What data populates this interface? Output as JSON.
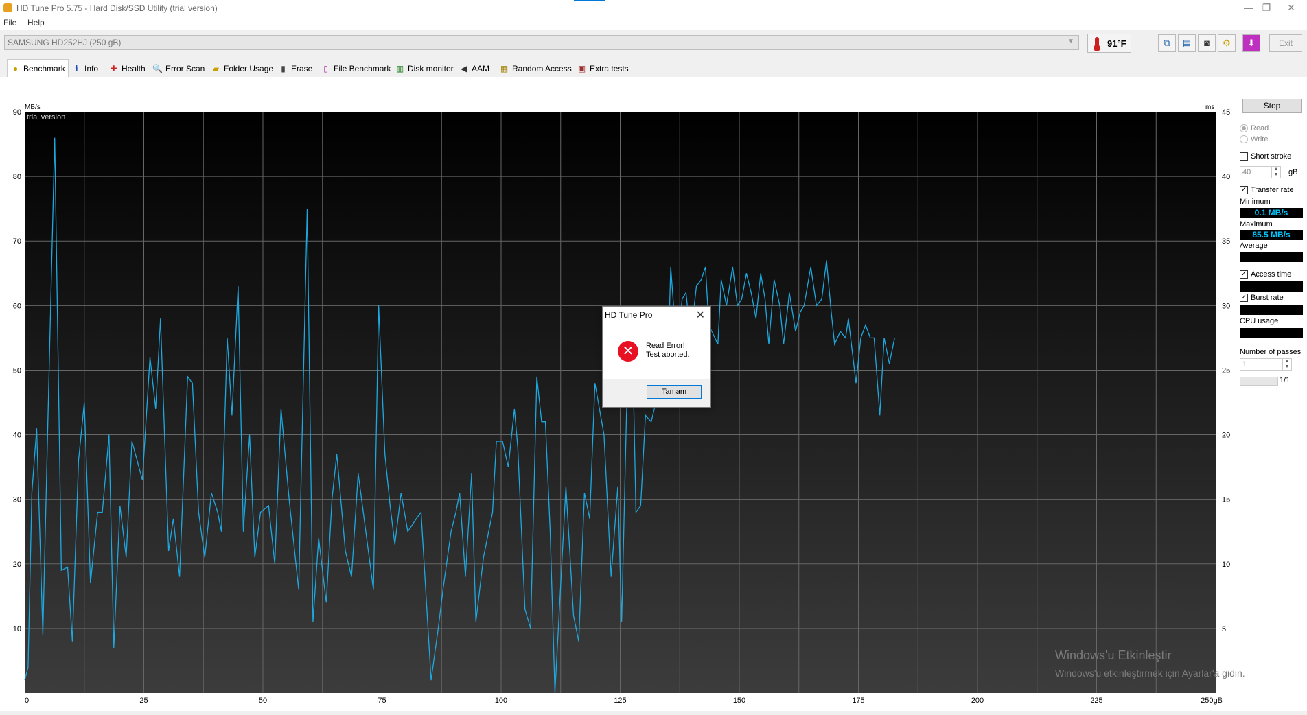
{
  "window": {
    "title": "HD Tune Pro 5.75 - Hard Disk/SSD Utility (trial version)",
    "minimize": "—",
    "restore": "❐",
    "close": "✕"
  },
  "menu": {
    "file": "File",
    "help": "Help"
  },
  "toolbar": {
    "drive": "SAMSUNG HD252HJ (250 gB)",
    "temperature": "91°F",
    "exit": "Exit"
  },
  "tabs": [
    {
      "label": "Benchmark",
      "icon": "benchmark-icon"
    },
    {
      "label": "Info",
      "icon": "info-icon"
    },
    {
      "label": "Health",
      "icon": "health-icon"
    },
    {
      "label": "Error Scan",
      "icon": "error-scan-icon"
    },
    {
      "label": "Folder Usage",
      "icon": "folder-icon"
    },
    {
      "label": "Erase",
      "icon": "erase-icon"
    },
    {
      "label": "File Benchmark",
      "icon": "file-benchmark-icon"
    },
    {
      "label": "Disk monitor",
      "icon": "disk-monitor-icon"
    },
    {
      "label": "AAM",
      "icon": "speaker-icon"
    },
    {
      "label": "Random Access",
      "icon": "random-access-icon"
    },
    {
      "label": "Extra tests",
      "icon": "extra-tests-icon"
    }
  ],
  "sidebar": {
    "stop": "Stop",
    "read": "Read",
    "write": "Write",
    "short_stroke": "Short stroke",
    "short_stroke_value": "40",
    "short_stroke_unit": "gB",
    "transfer_rate": "Transfer rate",
    "minimum_label": "Minimum",
    "minimum_value": "0.1 MB/s",
    "maximum_label": "Maximum",
    "maximum_value": "85.5 MB/s",
    "average_label": "Average",
    "access_time": "Access time",
    "burst_rate": "Burst rate",
    "cpu_usage": "CPU usage",
    "passes_label": "Number of passes",
    "passes_value": "1",
    "pass_progress": "1/1"
  },
  "dialog": {
    "title": "HD Tune Pro",
    "line1": "Read Error!",
    "line2": "Test aborted.",
    "ok": "Tamam"
  },
  "activation": {
    "line1": "Windows'u Etkinleştir",
    "line2": "Windows'u etkinleştirmek için Ayarlar'a gidin."
  },
  "colors": {
    "plot_line": "#1ea8e0",
    "plot_bg_top": "#000000",
    "plot_bg_bottom": "#3c3c3c",
    "error_icon": "#e81123"
  },
  "chart_data": {
    "type": "line",
    "title": "",
    "watermark": "trial version",
    "ylabel": "MB/s",
    "ylabel_right": "ms",
    "xunit": "gB",
    "xlim": [
      0,
      250
    ],
    "ylim": [
      0,
      90
    ],
    "ylim_right": [
      0,
      45
    ],
    "x_ticks": [
      0,
      25,
      50,
      75,
      100,
      125,
      150,
      175,
      200,
      225,
      250
    ],
    "x_tick_labels": [
      "0",
      "25",
      "50",
      "75",
      "100",
      "125",
      "150",
      "175",
      "200",
      "225",
      "250gB"
    ],
    "y_ticks": [
      10,
      20,
      30,
      40,
      50,
      60,
      70,
      80,
      90
    ],
    "y_right_ticks": [
      5,
      10,
      15,
      20,
      25,
      30,
      35,
      40,
      45
    ],
    "grid": true,
    "series": [
      {
        "values": [
          [
            0,
            2
          ],
          [
            0.7,
            4
          ],
          [
            1.5,
            31
          ],
          [
            2.5,
            41
          ],
          [
            3.8,
            9
          ],
          [
            4.8,
            40
          ],
          [
            6.3,
            86
          ],
          [
            7.7,
            19
          ],
          [
            9,
            19.5
          ],
          [
            10,
            8
          ],
          [
            11.3,
            36
          ],
          [
            12.5,
            45
          ],
          [
            13.8,
            17
          ],
          [
            15.3,
            28
          ],
          [
            16.3,
            28
          ],
          [
            17.7,
            40
          ],
          [
            18.7,
            7
          ],
          [
            20,
            29
          ],
          [
            21.3,
            21
          ],
          [
            22.5,
            39
          ],
          [
            24.7,
            33
          ],
          [
            26.3,
            52
          ],
          [
            27.5,
            44
          ],
          [
            28.5,
            58
          ],
          [
            30.2,
            22
          ],
          [
            31.2,
            27
          ],
          [
            32.5,
            18
          ],
          [
            34.2,
            49
          ],
          [
            35.2,
            48
          ],
          [
            36.5,
            28
          ],
          [
            37.8,
            21
          ],
          [
            39.2,
            31
          ],
          [
            40.5,
            28
          ],
          [
            41.3,
            25
          ],
          [
            42.5,
            55
          ],
          [
            43.5,
            43
          ],
          [
            44.8,
            63
          ],
          [
            45.9,
            25
          ],
          [
            47.2,
            40
          ],
          [
            48.3,
            21
          ],
          [
            49.5,
            28
          ],
          [
            51.2,
            29
          ],
          [
            52.5,
            20
          ],
          [
            53.8,
            44
          ],
          [
            55.5,
            30
          ],
          [
            57.5,
            16
          ],
          [
            59.3,
            75
          ],
          [
            60.5,
            11
          ],
          [
            61.7,
            24
          ],
          [
            63.3,
            14
          ],
          [
            64.5,
            30
          ],
          [
            65.5,
            37
          ],
          [
            67.3,
            22
          ],
          [
            68.6,
            18
          ],
          [
            70,
            34
          ],
          [
            71.6,
            25
          ],
          [
            73.2,
            16
          ],
          [
            74.3,
            60
          ],
          [
            75.6,
            37
          ],
          [
            76.7,
            29
          ],
          [
            77.7,
            23
          ],
          [
            79,
            31
          ],
          [
            80.4,
            25
          ],
          [
            82.2,
            27
          ],
          [
            83.2,
            28
          ],
          [
            85.3,
            2
          ],
          [
            86.8,
            10
          ],
          [
            87.8,
            16
          ],
          [
            89.5,
            25
          ],
          [
            90.5,
            28
          ],
          [
            91.3,
            31
          ],
          [
            92.5,
            18
          ],
          [
            93.8,
            34
          ],
          [
            94.7,
            11
          ],
          [
            96.3,
            21
          ],
          [
            98.2,
            28
          ],
          [
            99,
            39
          ],
          [
            100.3,
            39
          ],
          [
            101.5,
            35
          ],
          [
            102.8,
            44
          ],
          [
            103.5,
            38
          ],
          [
            105,
            13
          ],
          [
            106.2,
            10
          ],
          [
            107.5,
            49
          ],
          [
            108.5,
            42
          ],
          [
            109.3,
            42
          ],
          [
            110.3,
            25
          ],
          [
            111.3,
            0
          ],
          [
            113.6,
            32
          ],
          [
            115.2,
            12
          ],
          [
            116.3,
            8
          ],
          [
            117.5,
            31
          ],
          [
            118.6,
            27
          ],
          [
            119.7,
            48
          ],
          [
            121.6,
            40
          ],
          [
            123.1,
            18
          ],
          [
            124.5,
            32
          ],
          [
            125.3,
            11
          ],
          [
            126.6,
            52
          ],
          [
            127.5,
            57
          ],
          [
            128.3,
            28
          ],
          [
            129.3,
            29
          ],
          [
            130.3,
            43
          ],
          [
            131.5,
            42
          ],
          [
            133.8,
            49
          ],
          [
            135,
            50
          ],
          [
            135.6,
            66
          ],
          [
            136.4,
            58
          ],
          [
            137,
            54
          ],
          [
            138,
            61
          ],
          [
            138.8,
            62
          ],
          [
            139.8,
            55
          ],
          [
            141,
            63
          ],
          [
            142,
            64
          ],
          [
            142.9,
            66
          ],
          [
            143.6,
            57
          ],
          [
            145.5,
            54
          ],
          [
            146.2,
            64
          ],
          [
            147.3,
            60
          ],
          [
            148.6,
            66
          ],
          [
            149.6,
            60
          ],
          [
            150.5,
            61
          ],
          [
            151.5,
            65
          ],
          [
            152.5,
            62
          ],
          [
            153.5,
            58
          ],
          [
            154.5,
            65
          ],
          [
            155.4,
            61
          ],
          [
            156.2,
            54
          ],
          [
            157.3,
            64
          ],
          [
            158.5,
            60
          ],
          [
            159.3,
            54
          ],
          [
            160.5,
            62
          ],
          [
            161.8,
            56
          ],
          [
            162.8,
            59
          ],
          [
            163.6,
            60
          ],
          [
            165,
            66
          ],
          [
            166.2,
            60
          ],
          [
            167.3,
            61
          ],
          [
            168.3,
            67
          ],
          [
            169.3,
            59
          ],
          [
            170,
            54
          ],
          [
            171.2,
            56
          ],
          [
            172.3,
            55
          ],
          [
            172.9,
            58
          ],
          [
            174.5,
            48
          ],
          [
            175.5,
            55
          ],
          [
            176.5,
            57
          ],
          [
            177.5,
            55
          ],
          [
            178.3,
            55
          ],
          [
            179.5,
            43
          ],
          [
            180.4,
            55
          ],
          [
            181.5,
            51
          ],
          [
            182.6,
            55
          ]
        ]
      }
    ]
  }
}
